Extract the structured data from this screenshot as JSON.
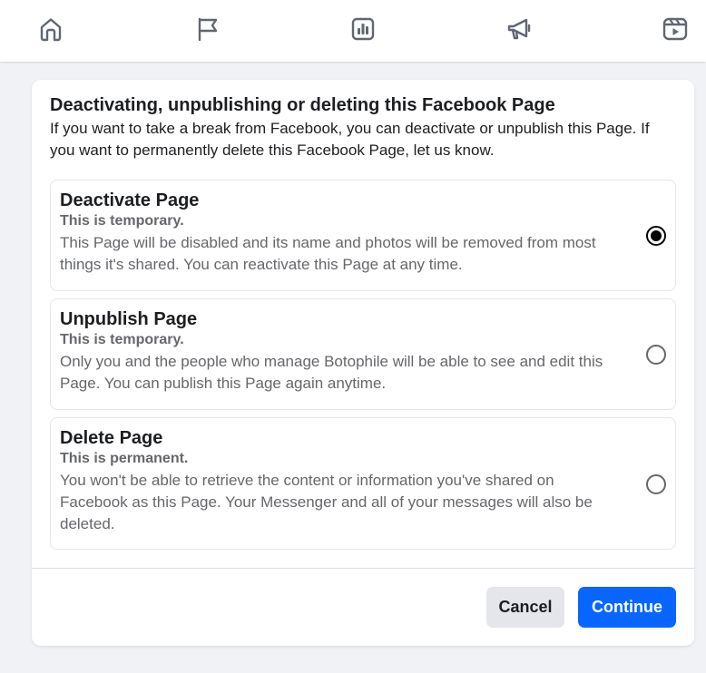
{
  "nav": {
    "items": [
      {
        "icon": "home-icon"
      },
      {
        "icon": "flag-icon"
      },
      {
        "icon": "insights-icon"
      },
      {
        "icon": "megaphone-icon"
      },
      {
        "icon": "reels-icon"
      }
    ]
  },
  "dialog": {
    "title": "Deactivating, unpublishing or deleting this Facebook Page",
    "description": "If you want to take a break from Facebook, you can deactivate or unpublish this Page. If you want to permanently delete this Facebook Page, let us know.",
    "options": [
      {
        "title": "Deactivate Page",
        "subtitle": "This is temporary.",
        "body": "This Page will be disabled and its name and photos will be removed from most things it's shared. You can reactivate this Page at any time.",
        "selected": true
      },
      {
        "title": "Unpublish Page",
        "subtitle": "This is temporary.",
        "body": "Only you and the people who manage Botophile will be able to see and edit this Page. You can publish this Page again anytime.",
        "selected": false
      },
      {
        "title": "Delete Page",
        "subtitle": "This is permanent.",
        "body": "You won't be able to retrieve the content or information you've shared on Facebook as this Page. Your Messenger and all of your messages will also be deleted.",
        "selected": false
      }
    ],
    "cancel_label": "Cancel",
    "continue_label": "Continue"
  },
  "colors": {
    "accent": "#0866ff",
    "background": "#f0f2f5",
    "secondary_text": "#65676b"
  }
}
